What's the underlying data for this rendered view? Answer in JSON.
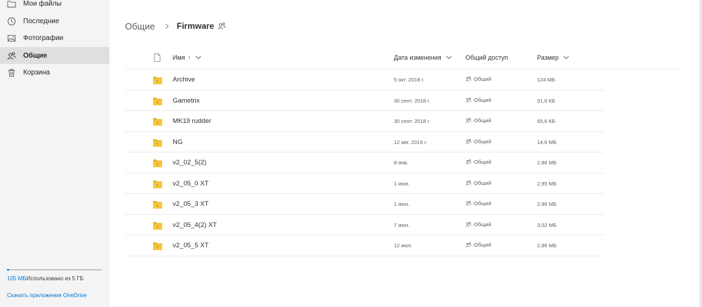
{
  "sidebar": {
    "items": [
      {
        "label": "Мои файлы",
        "icon": "folder-icon"
      },
      {
        "label": "Последние",
        "icon": "clock-icon"
      },
      {
        "label": "Фотографии",
        "icon": "photo-icon"
      },
      {
        "label": "Общие",
        "icon": "people-icon",
        "active": true
      },
      {
        "label": "Корзина",
        "icon": "trash-icon"
      }
    ],
    "storage": {
      "used": "105 МБ",
      "rest": "Использовано из 5 ГБ",
      "fraction_used": 0.02
    },
    "get_apps_link": "Скачать приложения OneDrive"
  },
  "breadcrumb": {
    "root": "Общие",
    "current": "Firmware"
  },
  "table": {
    "headers": {
      "name": "Имя",
      "name_sort": "↑",
      "modified": "Дата изменения",
      "sharing": "Общий доступ",
      "size": "Размер"
    },
    "rows": [
      {
        "name": "Archive",
        "modified": "5 окт. 2018 г.",
        "sharing": "Общий",
        "size": "124 МБ"
      },
      {
        "name": "Gametrix",
        "modified": "30 сент. 2018 г.",
        "sharing": "Общий",
        "size": "31,0 КБ"
      },
      {
        "name": "MK19 rudder",
        "modified": "30 сент. 2018 г.",
        "sharing": "Общий",
        "size": "65,6 КБ"
      },
      {
        "name": "NG",
        "modified": "12 авг. 2019 г.",
        "sharing": "Общий",
        "size": "14,6 МБ"
      },
      {
        "name": "v2_02_5(2)",
        "modified": "8 янв.",
        "sharing": "Общий",
        "size": "2,86 МБ"
      },
      {
        "name": "v2_05_0 XT",
        "modified": "1 июн.",
        "sharing": "Общий",
        "size": "2,95 МБ"
      },
      {
        "name": "v2_05_3 XT",
        "modified": "1 июн.",
        "sharing": "Общий",
        "size": "2,96 МБ"
      },
      {
        "name": "v2_05_4(2) XT",
        "modified": "7 июн.",
        "sharing": "Общий",
        "size": "3,02 МБ"
      },
      {
        "name": "v2_05_5 XT",
        "modified": "12 июл.",
        "sharing": "Общий",
        "size": "2,96 МБ"
      }
    ]
  },
  "colors": {
    "accent": "#0078d4",
    "folder": "#f8c73c",
    "sidebar_bg": "#f4f4f4",
    "active_bg": "#e1dfdd"
  }
}
